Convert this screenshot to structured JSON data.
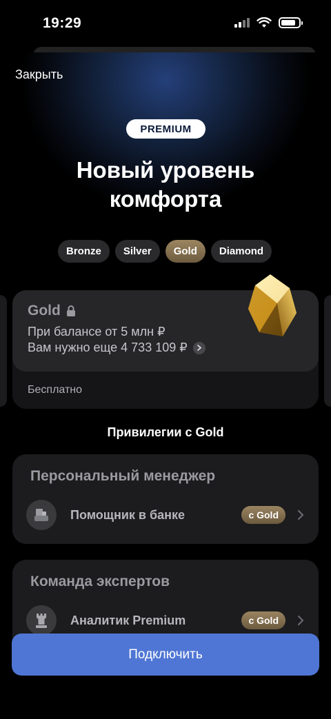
{
  "status_bar": {
    "time": "19:29",
    "battery_level": 0.85
  },
  "header": {
    "close_label": "Закрыть"
  },
  "hero": {
    "badge": "PREMIUM",
    "title": "Новый уровень комфорта"
  },
  "tiers": [
    {
      "label": "Bronze",
      "active": false
    },
    {
      "label": "Silver",
      "active": false
    },
    {
      "label": "Gold",
      "active": true
    },
    {
      "label": "Diamond",
      "active": false
    }
  ],
  "tier_card": {
    "name": "Gold",
    "condition": "При балансе от 5 млн ₽",
    "remaining": "Вам нужно еще 4 733 109 ₽",
    "price": "Бесплатно"
  },
  "privileges": {
    "title": "Привилегии с Gold",
    "groups": [
      {
        "title": "Персональный менеджер",
        "item_label": "Помощник в банке",
        "badge": "с Gold",
        "icon": "assistant-icon"
      },
      {
        "title": "Команда экспертов",
        "item_label": "Аналитик Premium",
        "badge": "с Gold",
        "icon": "chess-rook-icon"
      }
    ]
  },
  "cta": {
    "label": "Подключить"
  },
  "colors": {
    "accent": "#4f76d4",
    "gold": "#8a7452",
    "card": "#1c1c1e"
  }
}
